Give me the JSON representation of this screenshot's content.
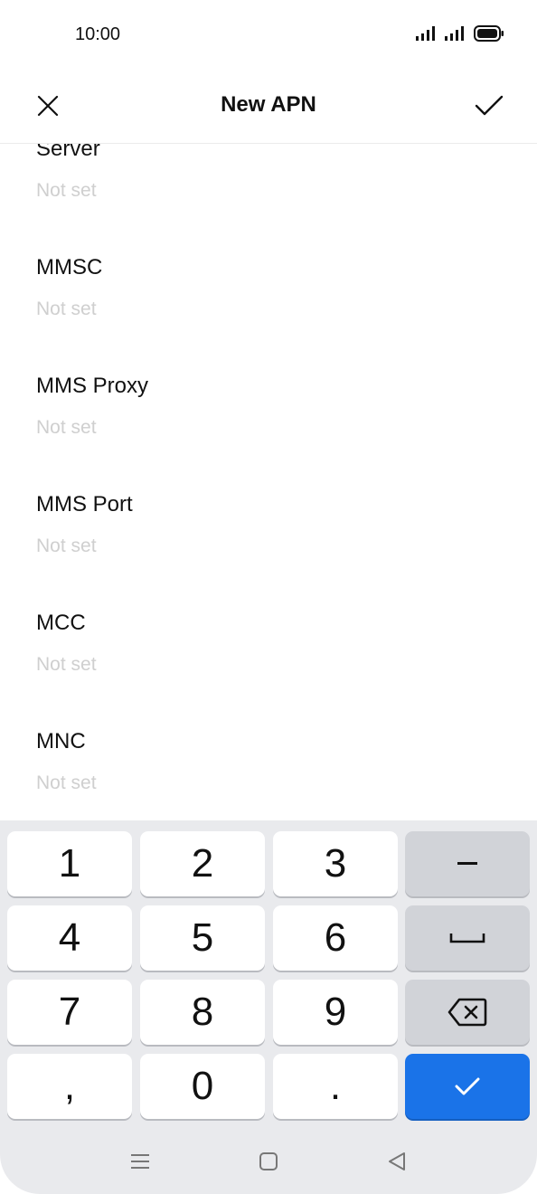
{
  "status_bar": {
    "time": "10:00",
    "icons": [
      "signal-icon",
      "signal-icon",
      "battery-icon"
    ]
  },
  "header": {
    "title": "New APN",
    "close_icon": "close-icon",
    "confirm_icon": "check-icon"
  },
  "settings": [
    {
      "label": "Server",
      "value": "Not set"
    },
    {
      "label": "MMSC",
      "value": "Not set"
    },
    {
      "label": "MMS Proxy",
      "value": "Not set"
    },
    {
      "label": "MMS Port",
      "value": "Not set"
    },
    {
      "label": "MCC",
      "value": "Not set"
    },
    {
      "label": "MNC",
      "value": "Not set"
    }
  ],
  "keyboard": {
    "keys": [
      "1",
      "2",
      "3",
      "4",
      "5",
      "6",
      "7",
      "8",
      "9",
      ",",
      "0",
      "."
    ],
    "function_keys": [
      "minus-icon",
      "space-icon",
      "backspace-icon",
      "enter-check-icon"
    ],
    "colors": {
      "enter": "#1a73e8",
      "function_key": "#d1d3d8",
      "background": "#e9eaed"
    }
  },
  "navbar": {
    "icons": [
      "menu-icon",
      "home-icon",
      "back-icon"
    ]
  }
}
